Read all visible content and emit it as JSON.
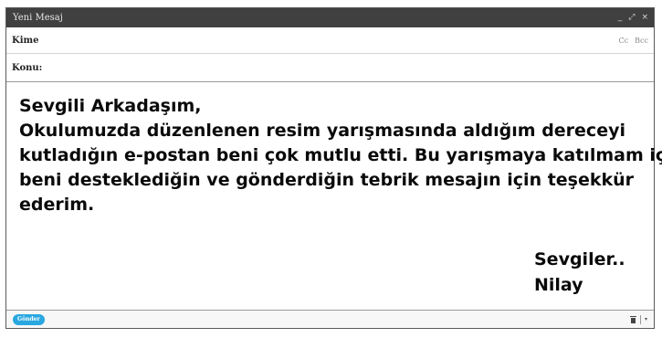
{
  "window": {
    "title": "Yeni Mesaj",
    "minimize_glyph": "_",
    "expand_glyph": "⤢",
    "close_glyph": "×"
  },
  "fields": {
    "to_label": "Kime",
    "to_value": "",
    "cc_label": "Cc",
    "bcc_label": "Bcc",
    "subject_label": "Konu:",
    "subject_value": ""
  },
  "body": {
    "lines": [
      "Sevgili Arkadaşım,",
      "Okulumuzda düzenlenen resim yarışmasında aldığım dereceyi",
      "kutladığın e-postan beni çok mutlu etti. Bu yarışmaya katılmam için",
      "beni desteklediğin ve gönderdiğin tebrik mesajın için teşekkür",
      "ederim."
    ],
    "signature": [
      "Sevgiler..",
      "Nilay"
    ]
  },
  "footer": {
    "send_label": "Gönder",
    "delete_icon": "trash-icon",
    "more_icon": "chevron-down-icon",
    "more_glyph": "▾"
  },
  "colors": {
    "titlebar_bg": "#404040",
    "send_button_bg": "#29a8e0"
  }
}
